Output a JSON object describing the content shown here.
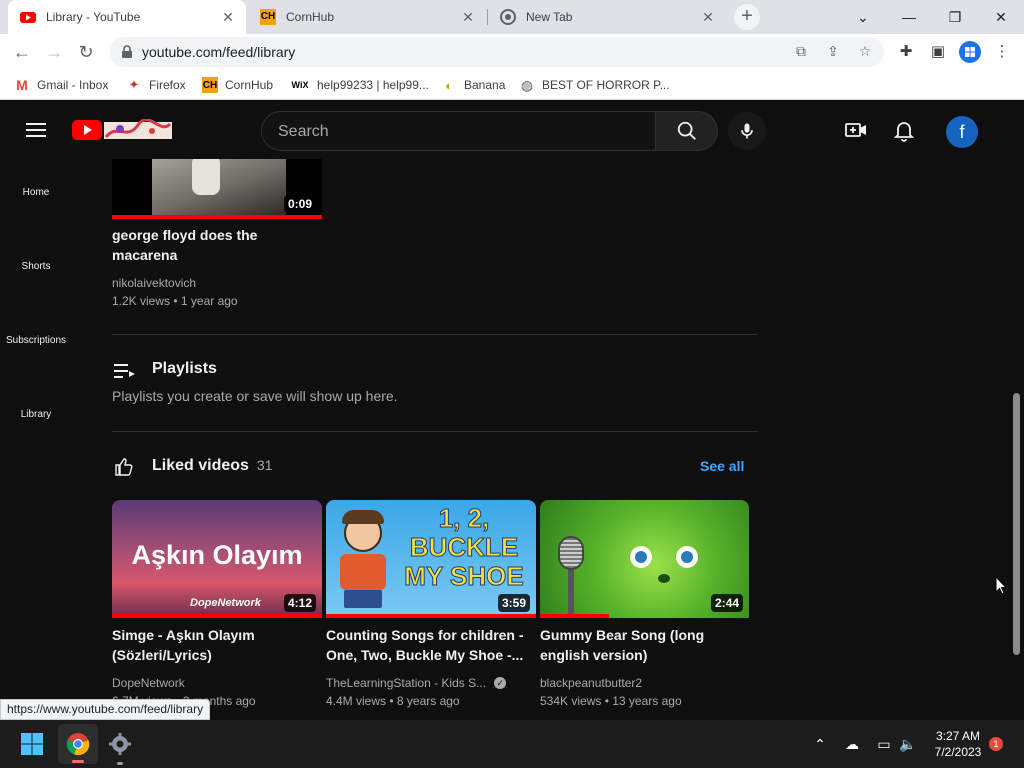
{
  "browser": {
    "tabs": [
      {
        "title": "Library - YouTube",
        "favicon": "youtube-icon",
        "active": true
      },
      {
        "title": "CornHub",
        "favicon": "cornhub-icon",
        "active": false
      },
      {
        "title": "New Tab",
        "favicon": "chrome-icon",
        "active": false
      }
    ],
    "url": "youtube.com/feed/library",
    "bookmarks": [
      {
        "label": "Gmail - Inbox",
        "icon": "gmail-icon"
      },
      {
        "label": "Firefox",
        "icon": "firefox-icon"
      },
      {
        "label": "CornHub",
        "icon": "cornhub-icon"
      },
      {
        "label": "help99233 | help99...",
        "icon": "wix-icon"
      },
      {
        "label": "Banana",
        "icon": "banana-icon"
      },
      {
        "label": "BEST OF HORROR P...",
        "icon": "globe-icon"
      }
    ],
    "status_url": "https://www.youtube.com/feed/library",
    "colors": {
      "tabstrip": "#dee1e6",
      "toolbar": "#ffffff"
    }
  },
  "youtube": {
    "search": {
      "placeholder": "Search"
    },
    "avatar_letter": "f",
    "guide": [
      {
        "label": "Home",
        "icon": "home-icon"
      },
      {
        "label": "Shorts",
        "icon": "shorts-icon"
      },
      {
        "label": "Subscriptions",
        "icon": "subscriptions-icon"
      },
      {
        "label": "Library",
        "icon": "library-icon"
      }
    ],
    "history_video": {
      "title": "george floyd does the macarena",
      "channel": "nikolaivektovich",
      "meta": "1.2K views • 1 year ago",
      "duration": "0:09",
      "watched_fraction": 1.0
    },
    "playlists": {
      "title": "Playlists",
      "empty_text": "Playlists you create or save will show up here."
    },
    "liked": {
      "title": "Liked videos",
      "count": "31",
      "see_all": "See all",
      "videos": [
        {
          "title": "Simge - Aşkın Olayım (Sözleri/Lyrics)",
          "channel": "DopeNetwork",
          "meta": "6.7M views • 2 months ago",
          "duration": "4:12",
          "thumb_text": "Aşkın Olayım",
          "thumb_sub": "DopeNetwork",
          "watched_fraction": 1.0,
          "verified": false
        },
        {
          "title": "Counting Songs for children - One, Two, Buckle My Shoe -...",
          "channel": "TheLearningStation - Kids S...",
          "meta": "4.4M views • 8 years ago",
          "duration": "3:59",
          "thumb_text": "1, 2, BUCKLE MY SHOE",
          "watched_fraction": 1.0,
          "verified": true
        },
        {
          "title": "Gummy Bear Song (long english version)",
          "channel": "blackpeanutbutter2",
          "meta": "534K views • 13 years ago",
          "duration": "2:44",
          "watched_fraction": 0.33,
          "verified": false
        }
      ]
    },
    "colors": {
      "background": "#0f0f0f",
      "accent": "#ff0000",
      "link": "#3ea6ff"
    }
  },
  "taskbar": {
    "time": "3:27 AM",
    "date": "7/2/2023",
    "notification_count": "1"
  }
}
